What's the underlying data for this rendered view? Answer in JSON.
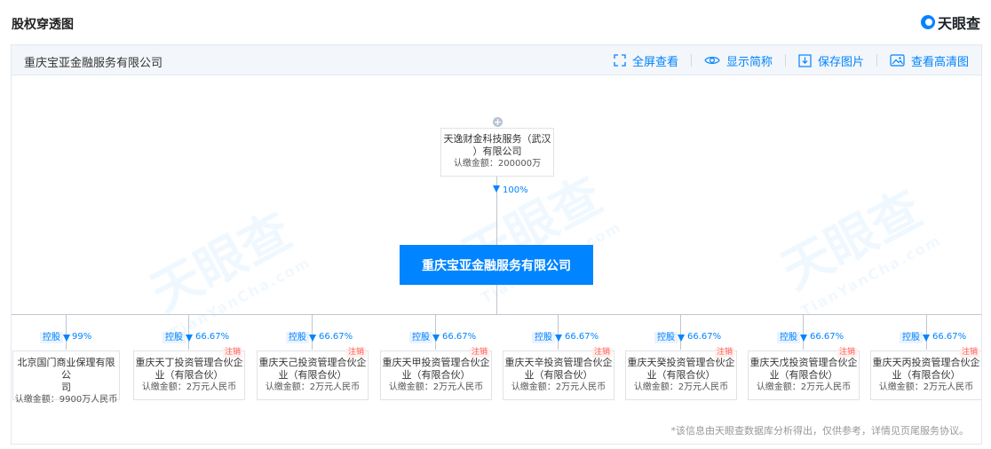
{
  "page": {
    "title": "股权穿透图",
    "brand": "天眼查"
  },
  "header": {
    "company_name": "重庆宝亚金融服务有限公司",
    "tools": {
      "fullscreen": "全屏查看",
      "show_abbr": "显示简称",
      "save_image": "保存图片",
      "hd_image": "查看高清图"
    }
  },
  "watermark": {
    "text": "天眼查",
    "latin": "TianYanCha.com"
  },
  "shareholder": {
    "name_line1": "天逸财金科技服务（武汉",
    "name_line2": "）有限公司",
    "capital": "认缴金额：200000万",
    "percent": "100%"
  },
  "root": {
    "name": "重庆宝亚金融服务有限公司"
  },
  "subsidiaries": [
    {
      "tag": "控股",
      "percent": "99%",
      "cancelled": "",
      "name_line1": "北京国门商业保理有限公",
      "name_line2": "司",
      "capital": "认缴金额：9900万人民币"
    },
    {
      "tag": "控股",
      "percent": "66.67%",
      "cancelled": "注销",
      "name_line1": "重庆天丁投资管理合伙企",
      "name_line2": "业（有限合伙）",
      "capital": "认缴金额：2万元人民币"
    },
    {
      "tag": "控股",
      "percent": "66.67%",
      "cancelled": "注销",
      "name_line1": "重庆天己投资管理合伙企",
      "name_line2": "业（有限合伙）",
      "capital": "认缴金额：2万元人民币"
    },
    {
      "tag": "控股",
      "percent": "66.67%",
      "cancelled": "注销",
      "name_line1": "重庆天甲投资管理合伙企",
      "name_line2": "业（有限合伙）",
      "capital": "认缴金额：2万元人民币"
    },
    {
      "tag": "控股",
      "percent": "66.67%",
      "cancelled": "注销",
      "name_line1": "重庆天辛投资管理合伙企",
      "name_line2": "业（有限合伙）",
      "capital": "认缴金额：2万元人民币"
    },
    {
      "tag": "控股",
      "percent": "66.67%",
      "cancelled": "注销",
      "name_line1": "重庆天癸投资管理合伙企",
      "name_line2": "业（有限合伙）",
      "capital": "认缴金额：2万元人民币"
    },
    {
      "tag": "控股",
      "percent": "66.67%",
      "cancelled": "注销",
      "name_line1": "重庆天戊投资管理合伙企",
      "name_line2": "业（有限合伙）",
      "capital": "认缴金额：2万元人民币"
    },
    {
      "tag": "控股",
      "percent": "66.67%",
      "cancelled": "注销",
      "name_line1": "重庆天丙投资管理合伙企",
      "name_line2": "业（有限合伙）",
      "capital": "认缴金额：2万元人民币"
    }
  ],
  "footnote": "*该信息由天眼查数据库分析得出，仅供参考，详情见页尾服务协议。",
  "colors": {
    "accent": "#0084ff",
    "cancel": "#ff5b4d"
  }
}
